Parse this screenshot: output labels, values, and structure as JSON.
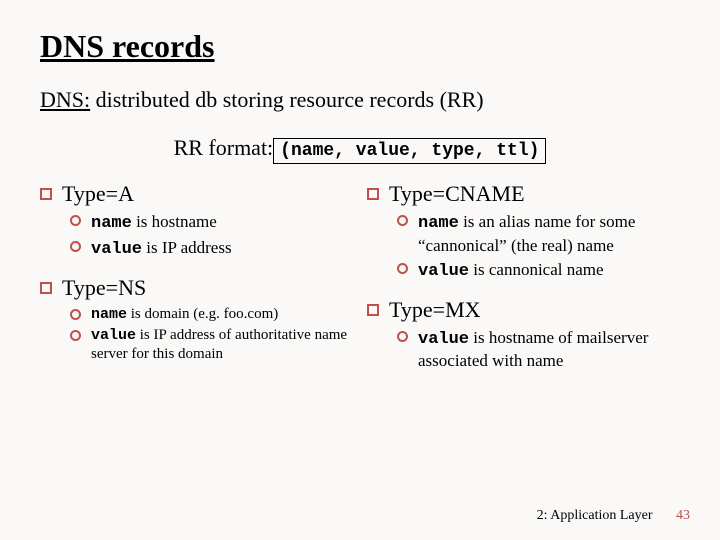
{
  "title": "DNS records",
  "subtitle": {
    "dns": "DNS:",
    "rest": " distributed db storing resource records (RR)"
  },
  "rr": {
    "label": "RR format: ",
    "tuple": "(name, value, type, ttl)"
  },
  "left": {
    "a": {
      "head": "Type=A",
      "items": [
        {
          "pre": "name",
          "post": " is hostname"
        },
        {
          "pre": "value",
          "post": " is IP address"
        }
      ]
    },
    "ns": {
      "head": "Type=NS",
      "items": [
        {
          "pre": "name",
          "post": " is domain (e.g. foo.com)"
        },
        {
          "pre": "value",
          "post": " is IP address of authoritative name server for this domain"
        }
      ]
    }
  },
  "right": {
    "cname": {
      "head": "Type=CNAME",
      "items": [
        {
          "pre": "name",
          "post": " is an alias name for some “cannonical” (the real) name"
        },
        {
          "pre": "value",
          "post": " is cannonical name"
        }
      ]
    },
    "mx": {
      "head": "Type=MX",
      "items": [
        {
          "pre": "value",
          "post": " is hostname of mailserver associated with name"
        }
      ]
    }
  },
  "footer": {
    "chapter": "2: Application Layer",
    "page": "43"
  }
}
